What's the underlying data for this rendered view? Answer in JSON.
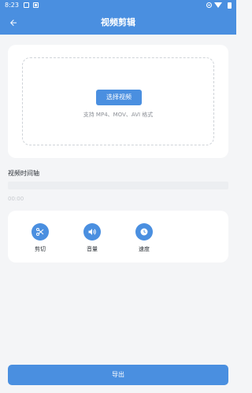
{
  "status_bar": {
    "time": "8:23",
    "icons": [
      "image-icon",
      "download-icon",
      "do-not-disturb-icon",
      "wifi-icon",
      "battery-icon"
    ]
  },
  "app_bar": {
    "title": "视频剪辑",
    "back_icon": "arrow-left-icon"
  },
  "upload": {
    "select_button_label": "选择视频",
    "support_text": "支持 MP4、MOV、AVI 格式"
  },
  "timeline": {
    "label": "视频时间轴",
    "time": "00:00"
  },
  "tools": [
    {
      "label": "剪切",
      "icon": "scissors-icon"
    },
    {
      "label": "音量",
      "icon": "volume-icon"
    },
    {
      "label": "速度",
      "icon": "clock-icon"
    }
  ],
  "export": {
    "label": "导出"
  },
  "colors": {
    "primary": "#4a8fe0",
    "background": "#f4f5f7",
    "card": "#ffffff",
    "muted_text": "#8b8f96"
  }
}
